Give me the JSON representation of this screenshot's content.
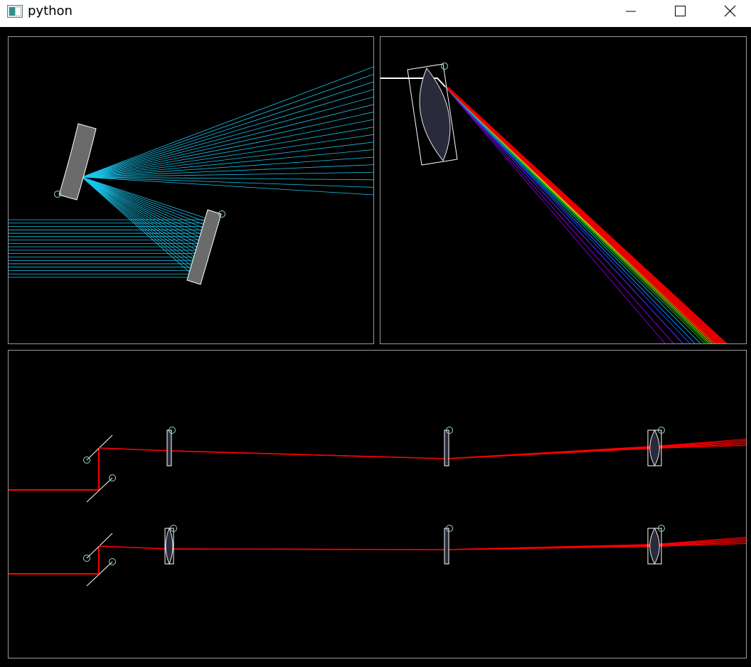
{
  "window": {
    "title": "python",
    "controls": {
      "minimize": "minimize-icon",
      "maximize": "maximize-icon",
      "close": "close-icon"
    }
  },
  "colors": {
    "background": "#000000",
    "panel_border": "#9a9a9a",
    "ray_cyan": "#19c6ee",
    "ray_red": "#ff0000",
    "mirror_fill": "#6b6b6b",
    "lens_fill": "#2a2b3a",
    "outline": "#ffffff",
    "handle": "#8fe0c8"
  },
  "scenes": [
    {
      "name": "mirror-reflection-scene",
      "objects": [
        "curved-mirror",
        "flat-mirror",
        "parallel-ray-bundle"
      ]
    },
    {
      "name": "lens-dispersion-scene",
      "objects": [
        "biconvex-lens",
        "white-light-ray",
        "spectrum-fan"
      ]
    },
    {
      "name": "optical-bench-scene",
      "objects": [
        "beam-splitter-pair",
        "thin-lens",
        "thin-lens",
        "thick-lens"
      ]
    }
  ]
}
